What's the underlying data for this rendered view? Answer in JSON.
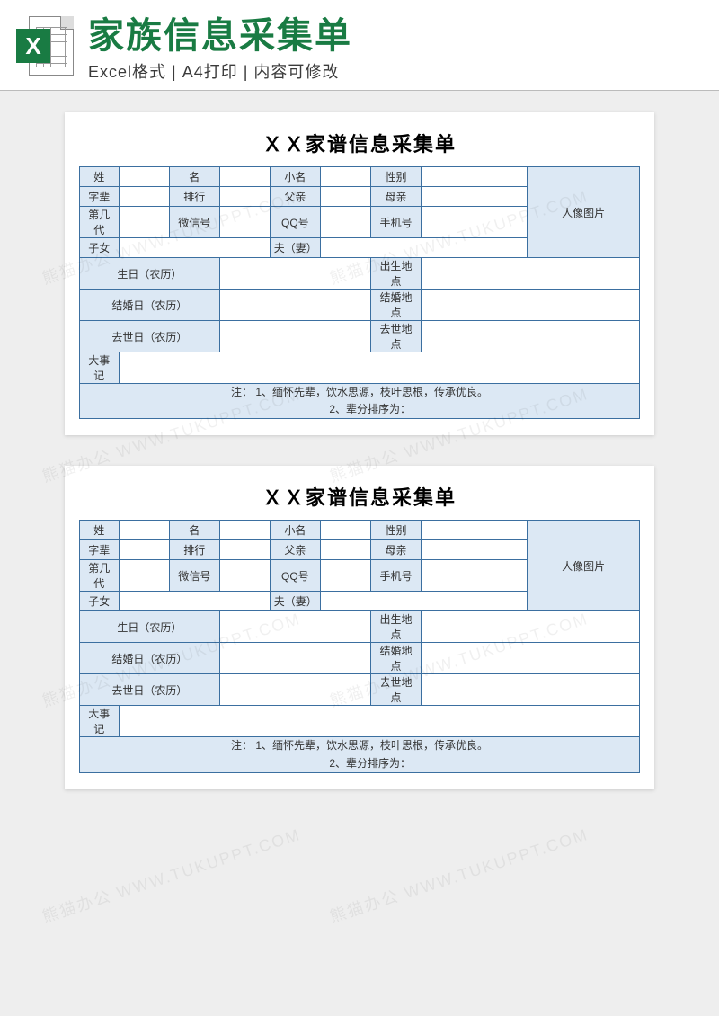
{
  "header": {
    "title": "家族信息采集单",
    "subtitle": "Excel格式 | A4打印 | 内容可修改",
    "icon_letter": "X"
  },
  "form": {
    "title": "ＸＸ家谱信息采集单",
    "labels": {
      "surname": "姓",
      "given": "名",
      "nickname": "小名",
      "gender": "性别",
      "photo": "人像图片",
      "generation_name": "字辈",
      "rank": "排行",
      "father": "父亲",
      "mother": "母亲",
      "gen_no": "第几代",
      "wechat": "微信号",
      "qq": "QQ号",
      "phone": "手机号",
      "children": "子女",
      "spouse": "夫（妻）",
      "birthday": "生日（农历）",
      "birthplace": "出生地点",
      "wed_date": "结婚日（农历）",
      "wed_place": "结婚地点",
      "death_date": "去世日（农历）",
      "death_place": "去世地点",
      "events": "大事记"
    },
    "notes_label": "注：",
    "notes": [
      "1、缅怀先辈，饮水思源，枝叶思根，传承优良。",
      "2、辈分排序为："
    ]
  },
  "watermark": "熊猫办公 WWW.TUKUPPT.COM"
}
